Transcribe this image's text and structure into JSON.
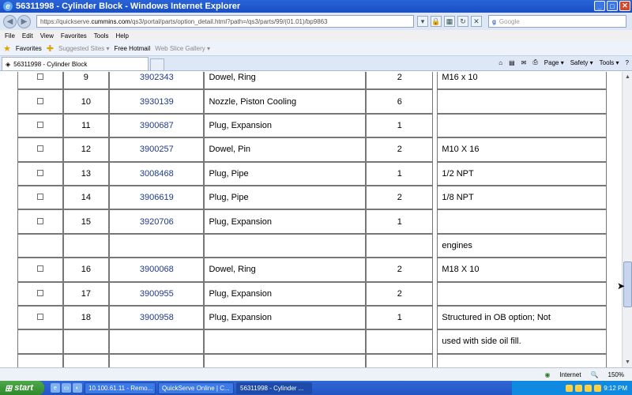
{
  "window": {
    "title": "56311998 - Cylinder Block - Windows Internet Explorer"
  },
  "address": {
    "prefix": "https://quickserve.",
    "domain": "cummins.com",
    "path": "/qs3/portal/parts/option_detail.html?path=/qs3/parts/99/(01.01)/bp9863"
  },
  "search": {
    "engine": "Google",
    "placeholder": "Google"
  },
  "menu": [
    "File",
    "Edit",
    "View",
    "Favorites",
    "Tools",
    "Help"
  ],
  "favorites": {
    "label": "Favorites",
    "items": [
      "Suggested Sites ▾",
      "Free Hotmail",
      "Web Slice Gallery ▾"
    ]
  },
  "tab": {
    "label": "56311998 - Cylinder Block"
  },
  "commandbar": [
    "Page ▾",
    "Safety ▾",
    "Tools ▾"
  ],
  "parts": [
    {
      "num": "9",
      "pn": "3902343",
      "desc": "Dowel, Ring",
      "qty": "2",
      "remarks": "M16 x 10",
      "checkbox": true
    },
    {
      "num": "10",
      "pn": "3930139",
      "desc": "Nozzle, Piston Cooling",
      "qty": "6",
      "remarks": "",
      "checkbox": true
    },
    {
      "num": "11",
      "pn": "3900687",
      "desc": "Plug, Expansion",
      "qty": "1",
      "remarks": "",
      "checkbox": true
    },
    {
      "num": "12",
      "pn": "3900257",
      "desc": "Dowel, Pin",
      "qty": "2",
      "remarks": "M10 X 16",
      "checkbox": true
    },
    {
      "num": "13",
      "pn": "3008468",
      "desc": "Plug, Pipe",
      "qty": "1",
      "remarks": "1/2 NPT",
      "checkbox": true
    },
    {
      "num": "14",
      "pn": "3906619",
      "desc": "Plug, Pipe",
      "qty": "2",
      "remarks": "1/8 NPT",
      "checkbox": true
    },
    {
      "num": "15",
      "pn": "3920706",
      "desc": "Plug, Expansion",
      "qty": "1",
      "remarks": "",
      "checkbox": true
    },
    {
      "num": "",
      "pn": "",
      "desc": "",
      "qty": "",
      "remarks": "engines",
      "checkbox": false
    },
    {
      "num": "16",
      "pn": "3900068",
      "desc": "Dowel, Ring",
      "qty": "2",
      "remarks": "M18 X 10",
      "checkbox": true
    },
    {
      "num": "17",
      "pn": "3900955",
      "desc": "Plug, Expansion",
      "qty": "2",
      "remarks": "",
      "checkbox": true
    },
    {
      "num": "18",
      "pn": "3900958",
      "desc": "Plug, Expansion",
      "qty": "1",
      "remarks": "Structured in OB option; Not",
      "checkbox": true
    },
    {
      "num": "",
      "pn": "",
      "desc": "",
      "qty": "",
      "remarks": "used with side oil fill.",
      "checkbox": false
    },
    {
      "num": "",
      "pn": "",
      "desc": "",
      "qty": "",
      "remarks": "",
      "checkbox": false
    }
  ],
  "status": {
    "zone": "Internet",
    "zoom": "150%"
  },
  "taskbar": {
    "start": "start",
    "tasks": [
      "10.100.61.11 - Remo...",
      "QuickServe Online | C...",
      "56311998 - Cylinder ..."
    ],
    "clock": "9:12 PM"
  }
}
